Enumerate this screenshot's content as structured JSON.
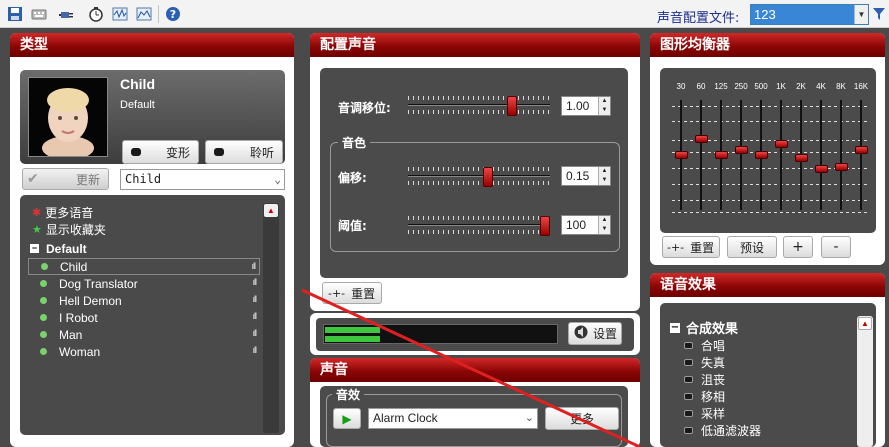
{
  "toolbar": {
    "config_label": "声音配置文件:",
    "config_value": "123"
  },
  "type_panel": {
    "title": "类型",
    "char_name": "Child",
    "char_sub": "Default",
    "morph_label": "变形",
    "listen_label": "聆听",
    "update_label": "更新",
    "voice_select": "Child",
    "list": {
      "more_voices": "更多语音",
      "show_favorites": "显示收藏夹",
      "group": "Default",
      "items": [
        "Child",
        "Dog Translator",
        "Hell Demon",
        "I Robot",
        "Man",
        "Woman"
      ]
    }
  },
  "voice_panel": {
    "title": "配置声音",
    "pitch_label": "音调移位:",
    "pitch_value": "1.00",
    "pitch_level": 0.75,
    "timbre_group": "音色",
    "offset_label": "偏移:",
    "offset_value": "0.15",
    "offset_level": 0.57,
    "threshold_label": "阈值:",
    "threshold_value": "100",
    "threshold_level": 1.0,
    "reset_label": "重置",
    "settings_label": "设置"
  },
  "sound_panel": {
    "title": "声音",
    "effects_group": "音效",
    "effect_select": "Alarm Clock",
    "more_label": "更多"
  },
  "eq_panel": {
    "title": "图形均衡器",
    "bands": [
      "30",
      "60",
      "125",
      "250",
      "500",
      "1K",
      "2K",
      "4K",
      "8K",
      "16K"
    ],
    "levels": [
      0.0,
      0.3,
      0.0,
      0.1,
      0.0,
      0.2,
      -0.05,
      -0.25,
      -0.22,
      0.1
    ],
    "reset_label": "重置",
    "preset_label": "预设",
    "add_label": "+",
    "remove_label": "-"
  },
  "effects_panel": {
    "title": "语音效果",
    "root": "合成效果",
    "items": [
      "合唱",
      "失真",
      "沮丧",
      "移相",
      "采样",
      "低通滤波器"
    ]
  }
}
